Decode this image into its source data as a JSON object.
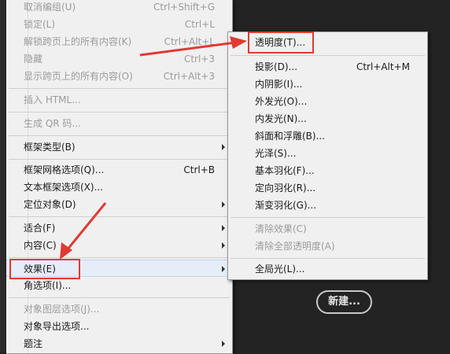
{
  "main_menu": {
    "items": [
      {
        "label": "取消编组(U)",
        "shortcut": "Ctrl+Shift+G",
        "disabled": true
      },
      {
        "label": "锁定(L)",
        "shortcut": "Ctrl+L",
        "disabled": true
      },
      {
        "label": "解锁跨页上的所有内容(K)",
        "shortcut": "Ctrl+Alt+L",
        "disabled": true
      },
      {
        "label": "隐藏",
        "shortcut": "Ctrl+3",
        "disabled": true
      },
      {
        "label": "显示跨页上的所有内容(O)",
        "shortcut": "Ctrl+Alt+3",
        "disabled": true
      },
      {
        "label": "插入 HTML...",
        "disabled": true
      },
      {
        "label": "生成 QR 码...",
        "disabled": true
      },
      {
        "label": "框架类型(B)",
        "submenu": true
      },
      {
        "label": "框架网格选项(Q)...",
        "shortcut": "Ctrl+B"
      },
      {
        "label": "文本框架选项(X)..."
      },
      {
        "label": "定位对象(D)",
        "submenu": true
      },
      {
        "label": "适合(F)",
        "submenu": true
      },
      {
        "label": "内容(C)",
        "submenu": true
      },
      {
        "label": "效果(E)",
        "submenu": true,
        "selected": true
      },
      {
        "label": "角选项(I)..."
      },
      {
        "label": "对象图层选项(J)...",
        "disabled": true
      },
      {
        "label": "对象导出选项..."
      },
      {
        "label": "题注",
        "submenu": true
      }
    ]
  },
  "effects_submenu": {
    "items": [
      {
        "label": "透明度(T)..."
      },
      {
        "label": "投影(D)...",
        "shortcut": "Ctrl+Alt+M"
      },
      {
        "label": "内阴影(I)..."
      },
      {
        "label": "外发光(O)..."
      },
      {
        "label": "内发光(N)..."
      },
      {
        "label": "斜面和浮雕(B)..."
      },
      {
        "label": "光泽(S)..."
      },
      {
        "label": "基本羽化(F)..."
      },
      {
        "label": "定向羽化(R)..."
      },
      {
        "label": "渐变羽化(G)..."
      },
      {
        "label": "清除效果(C)",
        "disabled": true
      },
      {
        "label": "清除全部透明度(A)",
        "disabled": true
      },
      {
        "label": "全局光(L)..."
      }
    ]
  },
  "new_button": {
    "label": "新建..."
  },
  "colors": {
    "annotation": "#e03a33",
    "menu_bg": "#f0f0f0",
    "canvas_bg": "#232323"
  }
}
